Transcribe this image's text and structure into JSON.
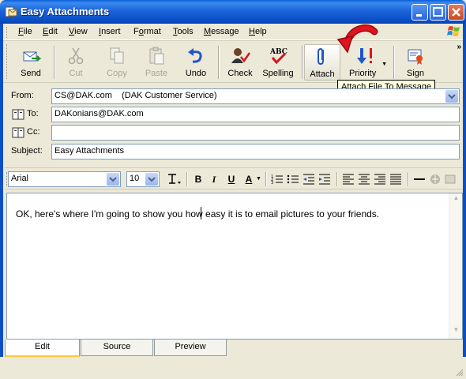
{
  "window": {
    "title": "Easy Attachments"
  },
  "menu": [
    {
      "label": "File",
      "key": "F",
      "rest": "ile"
    },
    {
      "label": "Edit",
      "key": "E",
      "rest": "dit"
    },
    {
      "label": "View",
      "key": "V",
      "rest": "iew"
    },
    {
      "label": "Insert",
      "key": "I",
      "rest": "nsert"
    },
    {
      "label": "Format",
      "key": "o",
      "pre": "F",
      "rest": "rmat"
    },
    {
      "label": "Tools",
      "key": "T",
      "rest": "ools"
    },
    {
      "label": "Message",
      "key": "M",
      "rest": "essage"
    },
    {
      "label": "Help",
      "key": "H",
      "rest": "elp"
    }
  ],
  "toolbar": {
    "send": "Send",
    "cut": "Cut",
    "copy": "Copy",
    "paste": "Paste",
    "undo": "Undo",
    "check": "Check",
    "spelling": "Spelling",
    "attach": "Attach",
    "priority": "Priority",
    "sign": "Sign",
    "more": "»"
  },
  "tooltip": "Attach File To Message",
  "header": {
    "from_label": "From:",
    "from_value": "CS@DAK.com    (DAK Customer Service)",
    "to_label": "To:",
    "to_value": "DAKonians@DAK.com",
    "cc_label": "Cc:",
    "cc_value": "",
    "subject_label": "Subject:",
    "subject_value": "Easy Attachments"
  },
  "format": {
    "font": "Arial",
    "size": "10",
    "bold": "B",
    "italic": "I",
    "underline": "U",
    "font_color": "A"
  },
  "editor": {
    "body": "OK, here's where I'm going to show you how easy it is to email pictures to your friends."
  },
  "tabs": [
    {
      "label": "Edit",
      "active": true
    },
    {
      "label": "Source",
      "active": false
    },
    {
      "label": "Preview",
      "active": false
    }
  ],
  "colors": {
    "titlebar": "#0A5FD9",
    "accent_arrow": "#E0141E",
    "tab_highlight": "#FFC83C"
  }
}
